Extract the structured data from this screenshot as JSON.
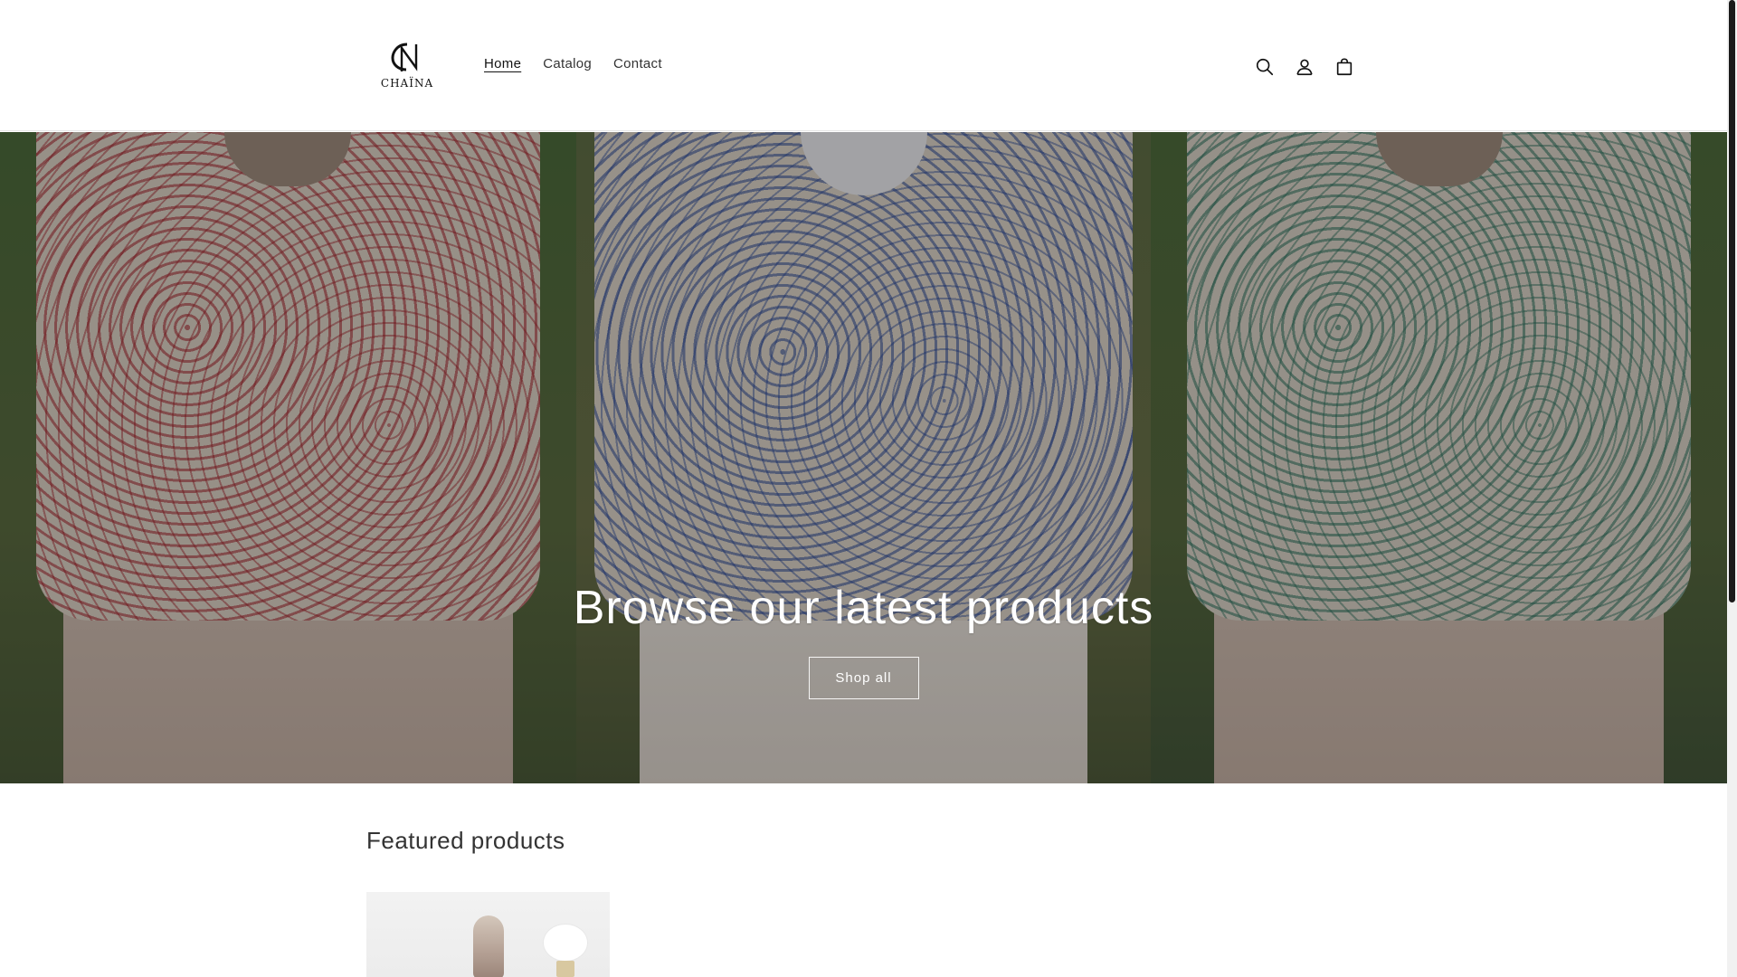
{
  "header": {
    "logo": {
      "text": "CHAÏNA",
      "mark": "CN"
    },
    "nav": [
      {
        "label": "Home",
        "active": true
      },
      {
        "label": "Catalog",
        "active": false
      },
      {
        "label": "Contact",
        "active": false
      }
    ],
    "icons": [
      "search-icon",
      "account-icon",
      "cart-icon"
    ]
  },
  "hero": {
    "title": "Browse our latest products",
    "button_label": "Shop all",
    "panel_colors": [
      "#a01e28",
      "#28468c",
      "#286e5a"
    ]
  },
  "featured": {
    "title": "Featured products"
  },
  "colors": {
    "text": "#121212",
    "overlay": "rgba(0,0,0,0.30)",
    "background": "#ffffff"
  }
}
